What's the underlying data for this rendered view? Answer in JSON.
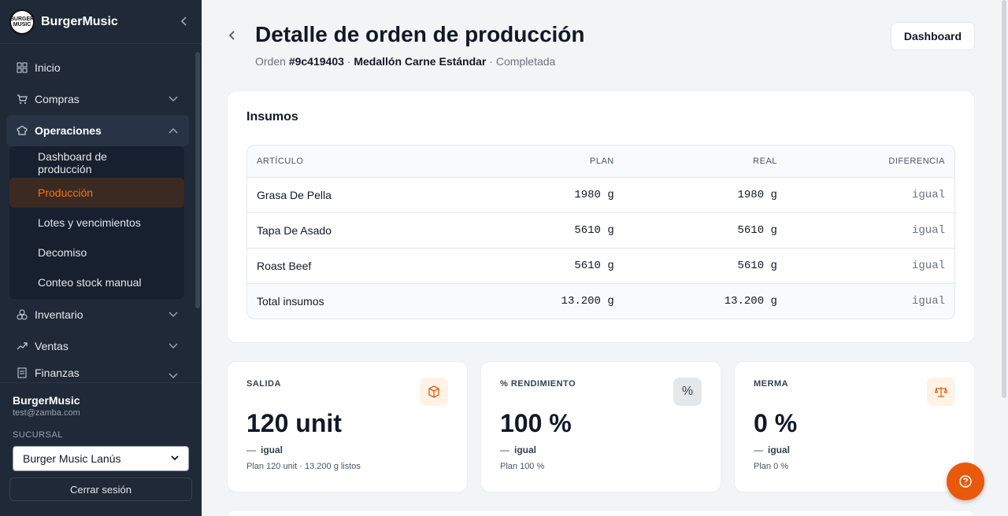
{
  "sidebar": {
    "brand_name": "BurgerMusic",
    "logo_text": "BURGER MUSIC",
    "nav": {
      "inicio": "Inicio",
      "compras": "Compras",
      "operaciones": "Operaciones",
      "inventario": "Inventario",
      "ventas": "Ventas",
      "finanzas": "Finanzas"
    },
    "sub": {
      "dashboard": "Dashboard de producción",
      "produccion": "Producción",
      "lotes": "Lotes y vencimientos",
      "decomiso": "Decomiso",
      "conteo": "Conteo stock manual"
    },
    "user_name": "BurgerMusic",
    "user_email": "test@zamba.com",
    "branch_label": "SUCURSAL",
    "branch_value": "Burger Music Lanús",
    "logout_label": "Cerrar sesión"
  },
  "header": {
    "title": "Detalle de orden de producción",
    "order_prefix": "Orden",
    "order_id": "#9c419403",
    "sep": "·",
    "product": "Medallón Carne Estándar",
    "status": "Completada",
    "dashboard_button": "Dashboard"
  },
  "insumos": {
    "title": "Insumos",
    "columns": [
      "ARTÍCULO",
      "PLAN",
      "REAL",
      "DIFERENCIA"
    ],
    "rows": [
      [
        "Grasa De Pella",
        "1980 g",
        "1980 g",
        "igual"
      ],
      [
        "Tapa De Asado",
        "5610 g",
        "5610 g",
        "igual"
      ],
      [
        "Roast Beef",
        "5610 g",
        "5610 g",
        "igual"
      ]
    ],
    "total": [
      "Total insumos",
      "13.200 g",
      "13.200 g",
      "igual"
    ]
  },
  "kpis": [
    {
      "label": "SALIDA",
      "value": "120 unit",
      "dash": "—",
      "delta": "igual",
      "plan": "Plan 120 unit · 13.200 g listos",
      "icon": "box-icon"
    },
    {
      "label": "% RENDIMIENTO",
      "value": "100 %",
      "dash": "—",
      "delta": "igual",
      "plan": "Plan 100 %",
      "icon": "percent-icon"
    },
    {
      "label": "MERMA",
      "value": "0 %",
      "dash": "—",
      "delta": "igual",
      "plan": "Plan 0 %",
      "icon": "scale-icon"
    }
  ],
  "colors": {
    "accent": "#ea580c",
    "sidebar_bg": "#1f2937",
    "active_text": "#f97316"
  }
}
